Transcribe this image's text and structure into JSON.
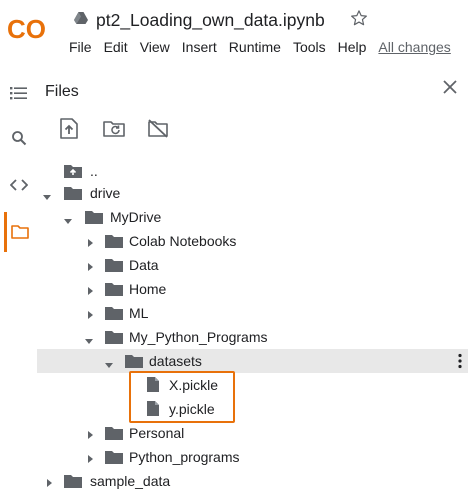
{
  "header": {
    "app_logo_text": "CO",
    "notebook_title": "pt2_Loading_own_data.ipynb",
    "menu": [
      "File",
      "Edit",
      "View",
      "Insert",
      "Runtime",
      "Tools",
      "Help"
    ],
    "save_status": "All changes"
  },
  "sidebar": {
    "active_panel": "files",
    "rail_icons": [
      "toc-icon",
      "search-icon",
      "code-snippets-icon",
      "folder-icon"
    ]
  },
  "files_panel": {
    "title": "Files",
    "toolbar": [
      "upload-icon",
      "refresh-icon",
      "drive-off-icon"
    ],
    "tree": [
      {
        "label": "..",
        "type": "parent",
        "depth": 0,
        "expanded": null
      },
      {
        "label": "drive",
        "type": "folder",
        "depth": 0,
        "expanded": true
      },
      {
        "label": "MyDrive",
        "type": "folder",
        "depth": 1,
        "expanded": true
      },
      {
        "label": "Colab Notebooks",
        "type": "folder",
        "depth": 2,
        "expanded": false
      },
      {
        "label": "Data",
        "type": "folder",
        "depth": 2,
        "expanded": false
      },
      {
        "label": "Home",
        "type": "folder",
        "depth": 2,
        "expanded": false
      },
      {
        "label": "ML",
        "type": "folder",
        "depth": 2,
        "expanded": false
      },
      {
        "label": "My_Python_Programs",
        "type": "folder",
        "depth": 2,
        "expanded": true
      },
      {
        "label": "datasets",
        "type": "folder",
        "depth": 3,
        "expanded": true,
        "selected": true
      },
      {
        "label": "X.pickle",
        "type": "file",
        "depth": 4,
        "expanded": null
      },
      {
        "label": "y.pickle",
        "type": "file",
        "depth": 4,
        "expanded": null
      },
      {
        "label": "Personal",
        "type": "folder",
        "depth": 2,
        "expanded": false
      },
      {
        "label": "Python_programs",
        "type": "folder",
        "depth": 2,
        "expanded": false
      },
      {
        "label": "sample_data",
        "type": "folder",
        "depth": 0,
        "expanded": false
      }
    ]
  },
  "colors": {
    "accent": "#e8710a",
    "logo_orange": "#f9ab00",
    "logo_red": "#e8710a",
    "selected_row": "#e8e8e8",
    "icon": "#5f6368",
    "folder": "#5f6368"
  }
}
